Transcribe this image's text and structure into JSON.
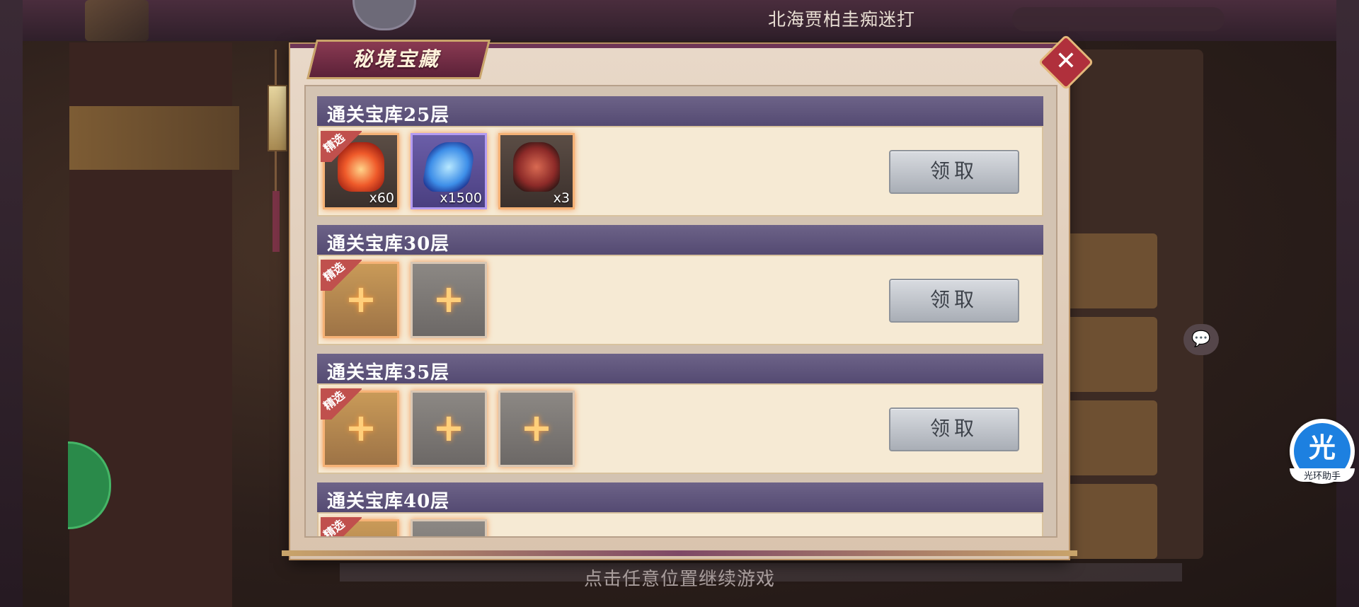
{
  "header": {
    "player_name": "北海贾柏圭痴迷打"
  },
  "dialog": {
    "title": "秘境宝藏",
    "claim_label": "领取",
    "featured_tag": "精选",
    "tiers": [
      {
        "title": "通关宝库25层",
        "items": [
          {
            "icon": "fire-emblem-icon",
            "qty": "x60",
            "featured": true
          },
          {
            "icon": "blue-crystal-icon",
            "qty": "x1500",
            "featured": false
          },
          {
            "icon": "red-shard-icon",
            "qty": "x3",
            "featured": false
          }
        ]
      },
      {
        "title": "通关宝库30层",
        "items": [
          {
            "icon": "plus-icon",
            "qty": "",
            "featured": true
          },
          {
            "icon": "plus-icon",
            "qty": "",
            "featured": false
          }
        ]
      },
      {
        "title": "通关宝库35层",
        "items": [
          {
            "icon": "plus-icon",
            "qty": "",
            "featured": true
          },
          {
            "icon": "plus-icon",
            "qty": "",
            "featured": false
          },
          {
            "icon": "plus-icon",
            "qty": "",
            "featured": false
          }
        ]
      },
      {
        "title": "通关宝库40层",
        "items": [
          {
            "icon": "plus-icon",
            "qty": "",
            "featured": true
          },
          {
            "icon": "plus-icon",
            "qty": "",
            "featured": false
          }
        ]
      }
    ]
  },
  "footer": {
    "continue_hint": "点击任意位置继续游戏"
  },
  "helper_widget": {
    "char": "光",
    "label": "光环助手"
  },
  "colors": {
    "tier_header": "#544a72",
    "dialog_accent": "#6e3556",
    "featured_tag": "#c0504d"
  }
}
